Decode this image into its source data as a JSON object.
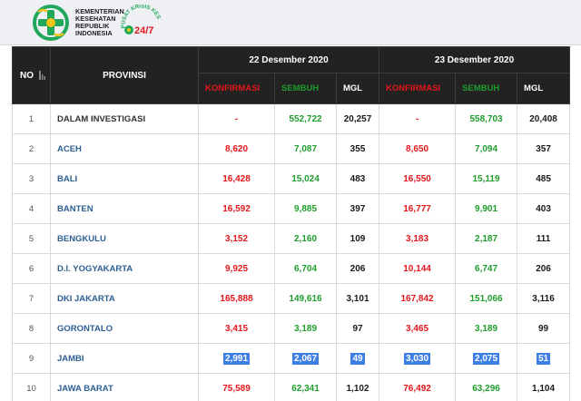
{
  "header": {
    "ministry_lines": [
      "KEMENTERIAN",
      "KESEHATAN",
      "REPUBLIK",
      "INDONESIA"
    ],
    "crisis_center_text": "PUSAT KRISIS KESEHATAN",
    "crisis_center_badge": "24/7"
  },
  "table": {
    "col_no": "NO",
    "col_provinsi": "PROVINSI",
    "dates": [
      "22 Desember 2020",
      "23 Desember 2020"
    ],
    "sub_headers": [
      "KONFIRMASI",
      "SEMBUH",
      "MGL"
    ],
    "rows": [
      {
        "no": "1",
        "provinsi": "DALAM INVESTIGASI",
        "d1": [
          "-",
          "552,722",
          "20,257"
        ],
        "d2": [
          "-",
          "558,703",
          "20,408"
        ]
      },
      {
        "no": "2",
        "provinsi": "ACEH",
        "d1": [
          "8,620",
          "7,087",
          "355"
        ],
        "d2": [
          "8,650",
          "7,094",
          "357"
        ]
      },
      {
        "no": "3",
        "provinsi": "BALI",
        "d1": [
          "16,428",
          "15,024",
          "483"
        ],
        "d2": [
          "16,550",
          "15,119",
          "485"
        ]
      },
      {
        "no": "4",
        "provinsi": "BANTEN",
        "d1": [
          "16,592",
          "9,885",
          "397"
        ],
        "d2": [
          "16,777",
          "9,901",
          "403"
        ]
      },
      {
        "no": "5",
        "provinsi": "BENGKULU",
        "d1": [
          "3,152",
          "2,160",
          "109"
        ],
        "d2": [
          "3,183",
          "2,187",
          "111"
        ]
      },
      {
        "no": "6",
        "provinsi": "D.I. YOGYAKARTA",
        "d1": [
          "9,925",
          "6,704",
          "206"
        ],
        "d2": [
          "10,144",
          "6,747",
          "206"
        ]
      },
      {
        "no": "7",
        "provinsi": "DKI JAKARTA",
        "d1": [
          "165,888",
          "149,616",
          "3,101"
        ],
        "d2": [
          "167,842",
          "151,066",
          "3,116"
        ]
      },
      {
        "no": "8",
        "provinsi": "GORONTALO",
        "d1": [
          "3,415",
          "3,189",
          "97"
        ],
        "d2": [
          "3,465",
          "3,189",
          "99"
        ]
      },
      {
        "no": "9",
        "provinsi": "JAMBI",
        "d1": [
          "2,991",
          "2,067",
          "49"
        ],
        "d2": [
          "3,030",
          "2,075",
          "51"
        ]
      },
      {
        "no": "10",
        "provinsi": "JAWA BARAT",
        "d1": [
          "75,589",
          "62,341",
          "1,102"
        ],
        "d2": [
          "76,492",
          "63,296",
          "1,104"
        ]
      }
    ]
  },
  "colors": {
    "header_bg": "#222222",
    "konfirmasi": "#e3171b",
    "sembuh": "#1f9d2d",
    "province_link": "#2d5f93",
    "selection": "#3d7fe3",
    "logo_green": "#1fa75a",
    "logo_yellow": "#f2c318"
  },
  "icons": {
    "ministry_logo": "kemenkes-logo-icon",
    "crisis_logo": "pusat-krisis-logo-icon",
    "sort": "sort-icon"
  }
}
